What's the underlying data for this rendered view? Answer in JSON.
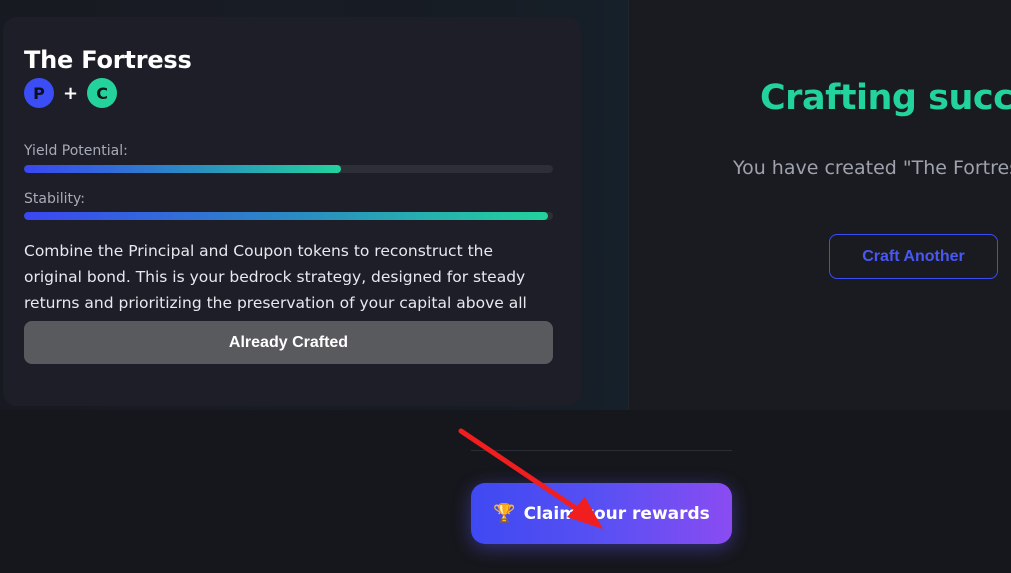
{
  "card": {
    "title": "The Fortress",
    "tokens": [
      {
        "letter": "P",
        "color": "#3b4df5"
      },
      {
        "letter": "C",
        "color": "#24d39b"
      }
    ],
    "plus": "+",
    "stats": [
      {
        "label": "Yield Potential:",
        "value": 0.6
      },
      {
        "label": "Stability:",
        "value": 0.99
      }
    ],
    "description": "Combine the Principal and Coupon tokens to reconstruct the original bond. This is your bedrock strategy, designed for steady returns and prioritizing the preservation of your capital above all else.",
    "button_label": "Already Crafted"
  },
  "result": {
    "title": "Crafting success",
    "subtitle": "You have created \"The Fortress\"",
    "craft_another_label": "Craft Another"
  },
  "claim": {
    "label": "Claim your rewards",
    "icon": "trophy-icon",
    "icon_glyph": "🏆"
  },
  "colors": {
    "accent_green": "#22d39c",
    "accent_blue": "#3b4df5",
    "annotation_arrow": "#f01e1e"
  }
}
